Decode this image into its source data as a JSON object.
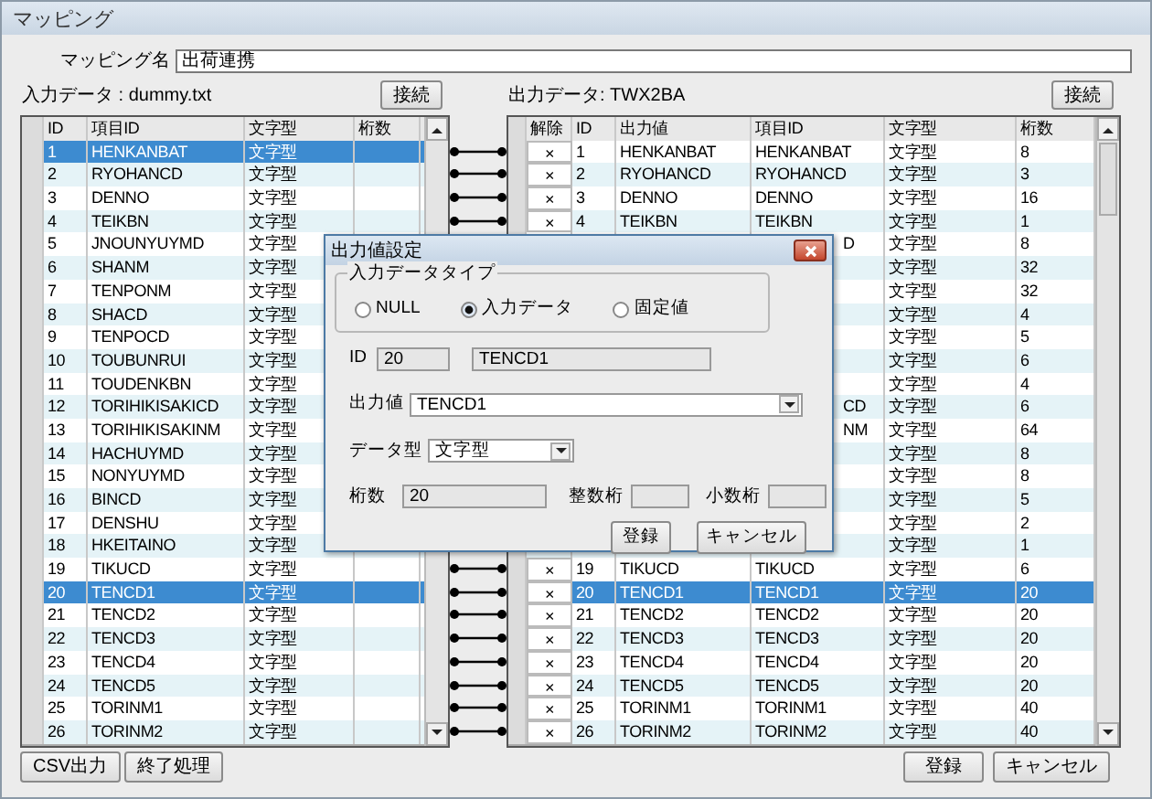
{
  "window": {
    "title": "マッピング"
  },
  "mapping_name": {
    "label": "マッピング名",
    "value": "出荷連携"
  },
  "input_panel": {
    "label": "入力データ : dummy.txt",
    "button": "接続",
    "columns": [
      "ID",
      "項目ID",
      "文字型",
      "桁数"
    ],
    "rows": [
      {
        "id": "1",
        "item_id": "HENKANBAT",
        "type": "文字型",
        "selected": true
      },
      {
        "id": "2",
        "item_id": "RYOHANCD",
        "type": "文字型",
        "selected": false
      },
      {
        "id": "3",
        "item_id": "DENNO",
        "type": "文字型",
        "selected": false
      },
      {
        "id": "4",
        "item_id": "TEIKBN",
        "type": "文字型",
        "selected": false
      },
      {
        "id": "5",
        "item_id": "JNOUNYUYMD",
        "type": "文字型",
        "selected": false
      },
      {
        "id": "6",
        "item_id": "SHANM",
        "type": "文字型",
        "selected": false
      },
      {
        "id": "7",
        "item_id": "TENPONM",
        "type": "文字型",
        "selected": false
      },
      {
        "id": "8",
        "item_id": "SHACD",
        "type": "文字型",
        "selected": false
      },
      {
        "id": "9",
        "item_id": "TENPOCD",
        "type": "文字型",
        "selected": false
      },
      {
        "id": "10",
        "item_id": "TOUBUNRUI",
        "type": "文字型",
        "selected": false
      },
      {
        "id": "11",
        "item_id": "TOUDENKBN",
        "type": "文字型",
        "selected": false
      },
      {
        "id": "12",
        "item_id": "TORIHIKISAKICD",
        "type": "文字型",
        "selected": false
      },
      {
        "id": "13",
        "item_id": "TORIHIKISAKINM",
        "type": "文字型",
        "selected": false
      },
      {
        "id": "14",
        "item_id": "HACHUYMD",
        "type": "文字型",
        "selected": false
      },
      {
        "id": "15",
        "item_id": "NONYUYMD",
        "type": "文字型",
        "selected": false
      },
      {
        "id": "16",
        "item_id": "BINCD",
        "type": "文字型",
        "selected": false
      },
      {
        "id": "17",
        "item_id": "DENSHU",
        "type": "文字型",
        "selected": false
      },
      {
        "id": "18",
        "item_id": "HKEITAINO",
        "type": "文字型",
        "selected": false
      },
      {
        "id": "19",
        "item_id": "TIKUCD",
        "type": "文字型",
        "selected": false
      },
      {
        "id": "20",
        "item_id": "TENCD1",
        "type": "文字型",
        "selected": true
      },
      {
        "id": "21",
        "item_id": "TENCD2",
        "type": "文字型",
        "selected": false
      },
      {
        "id": "22",
        "item_id": "TENCD3",
        "type": "文字型",
        "selected": false
      },
      {
        "id": "23",
        "item_id": "TENCD4",
        "type": "文字型",
        "selected": false
      },
      {
        "id": "24",
        "item_id": "TENCD5",
        "type": "文字型",
        "selected": false
      },
      {
        "id": "25",
        "item_id": "TORINM1",
        "type": "文字型",
        "selected": false
      },
      {
        "id": "26",
        "item_id": "TORINM2",
        "type": "文字型",
        "selected": false
      }
    ]
  },
  "output_panel": {
    "label": "出力データ: TWX2BA",
    "button": "接続",
    "columns": [
      "解除",
      "ID",
      "出力値",
      "項目ID",
      "文字型",
      "桁数"
    ],
    "rows": [
      {
        "kind": "full",
        "remove": "×",
        "id": "1",
        "output": "HENKANBAT",
        "item_id": "HENKANBAT",
        "type": "文字型",
        "digits": "8",
        "selected": false
      },
      {
        "kind": "full",
        "remove": "×",
        "id": "2",
        "output": "RYOHANCD",
        "item_id": "RYOHANCD",
        "type": "文字型",
        "digits": "3",
        "selected": false
      },
      {
        "kind": "full",
        "remove": "×",
        "id": "3",
        "output": "DENNO",
        "item_id": "DENNO",
        "type": "文字型",
        "digits": "16",
        "selected": false
      },
      {
        "kind": "full",
        "remove": "×",
        "id": "4",
        "output": "TEIKBN",
        "item_id": "TEIKBN",
        "type": "文字型",
        "digits": "1",
        "selected": false
      },
      {
        "kind": "covered",
        "item_id": "D",
        "type": "文字型",
        "digits": "8"
      },
      {
        "kind": "covered",
        "type": "文字型",
        "digits": "32"
      },
      {
        "kind": "covered",
        "type": "文字型",
        "digits": "32"
      },
      {
        "kind": "covered",
        "type": "文字型",
        "digits": "4"
      },
      {
        "kind": "covered",
        "type": "文字型",
        "digits": "5"
      },
      {
        "kind": "covered",
        "type": "文字型",
        "digits": "6"
      },
      {
        "kind": "covered",
        "type": "文字型",
        "digits": "4"
      },
      {
        "kind": "covered",
        "item_id": "CD",
        "type": "文字型",
        "digits": "6"
      },
      {
        "kind": "covered",
        "item_id": "NM",
        "type": "文字型",
        "digits": "64"
      },
      {
        "kind": "covered",
        "type": "文字型",
        "digits": "8"
      },
      {
        "kind": "covered",
        "type": "文字型",
        "digits": "8"
      },
      {
        "kind": "covered",
        "type": "文字型",
        "digits": "5"
      },
      {
        "kind": "covered",
        "type": "文字型",
        "digits": "2"
      },
      {
        "kind": "covered",
        "type": "文字型",
        "digits": "1"
      },
      {
        "kind": "full",
        "remove": "×",
        "id": "19",
        "output": "TIKUCD",
        "item_id": "TIKUCD",
        "type": "文字型",
        "digits": "6",
        "selected": false
      },
      {
        "kind": "full",
        "remove": "×",
        "id": "20",
        "output": "TENCD1",
        "item_id": "TENCD1",
        "type": "文字型",
        "digits": "20",
        "selected": true
      },
      {
        "kind": "full",
        "remove": "×",
        "id": "21",
        "output": "TENCD2",
        "item_id": "TENCD2",
        "type": "文字型",
        "digits": "20",
        "selected": false
      },
      {
        "kind": "full",
        "remove": "×",
        "id": "22",
        "output": "TENCD3",
        "item_id": "TENCD3",
        "type": "文字型",
        "digits": "20",
        "selected": false
      },
      {
        "kind": "full",
        "remove": "×",
        "id": "23",
        "output": "TENCD4",
        "item_id": "TENCD4",
        "type": "文字型",
        "digits": "20",
        "selected": false
      },
      {
        "kind": "full",
        "remove": "×",
        "id": "24",
        "output": "TENCD5",
        "item_id": "TENCD5",
        "type": "文字型",
        "digits": "20",
        "selected": false
      },
      {
        "kind": "full",
        "remove": "×",
        "id": "25",
        "output": "TORINM1",
        "item_id": "TORINM1",
        "type": "文字型",
        "digits": "40",
        "selected": false
      },
      {
        "kind": "full",
        "remove": "×",
        "id": "26",
        "output": "TORINM2",
        "item_id": "TORINM2",
        "type": "文字型",
        "digits": "40",
        "selected": false
      }
    ]
  },
  "footer_left": [
    "CSV出力",
    "終了処理"
  ],
  "footer_right": [
    "登録",
    "キャンセル"
  ],
  "dialog": {
    "title": "出力値設定",
    "group_label": "入力データタイプ",
    "options": [
      {
        "label": "NULL",
        "selected": false
      },
      {
        "label": "入力データ",
        "selected": true
      },
      {
        "label": "固定値",
        "selected": false
      }
    ],
    "id_label": "ID",
    "id_value": "20",
    "id_name": "TENCD1",
    "output_label": "出力値",
    "output_value": "TENCD1",
    "type_label": "データ型",
    "type_value": "文字型",
    "digits_label": "桁数",
    "digits_value": "20",
    "integer_label": "整数桁",
    "decimal_label": "小数桁",
    "buttons": [
      "登録",
      "キャンセル"
    ]
  }
}
